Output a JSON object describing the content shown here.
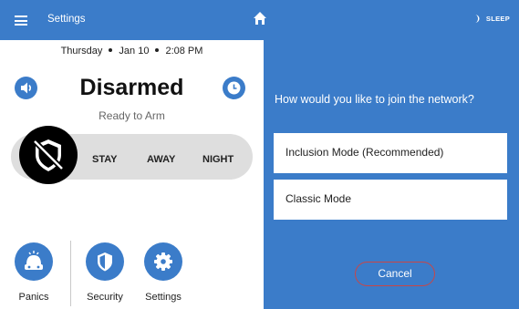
{
  "topbar": {
    "title": "Settings",
    "home_icon": "home-icon",
    "sleep_label": "SLEEP",
    "sleep_icon": "moon-icon"
  },
  "status": {
    "day": "Thursday",
    "date": "Jan 10",
    "time": "2:08 PM",
    "title": "Disarmed",
    "subtitle": "Ready to Arm"
  },
  "arm_modes": {
    "stay": "STAY",
    "away": "AWAY",
    "night": "NIGHT"
  },
  "bottom_nav": {
    "panics": "Panics",
    "security": "Security",
    "settings": "Settings"
  },
  "dialog": {
    "question": "How would you like to join the network?",
    "option_inclusion": "Inclusion Mode (Recommended)",
    "option_classic": "Classic Mode",
    "cancel": "Cancel"
  },
  "colors": {
    "accent": "#3b7cc9",
    "cancel_border": "#c94646",
    "arm_bar": "#dedede"
  }
}
